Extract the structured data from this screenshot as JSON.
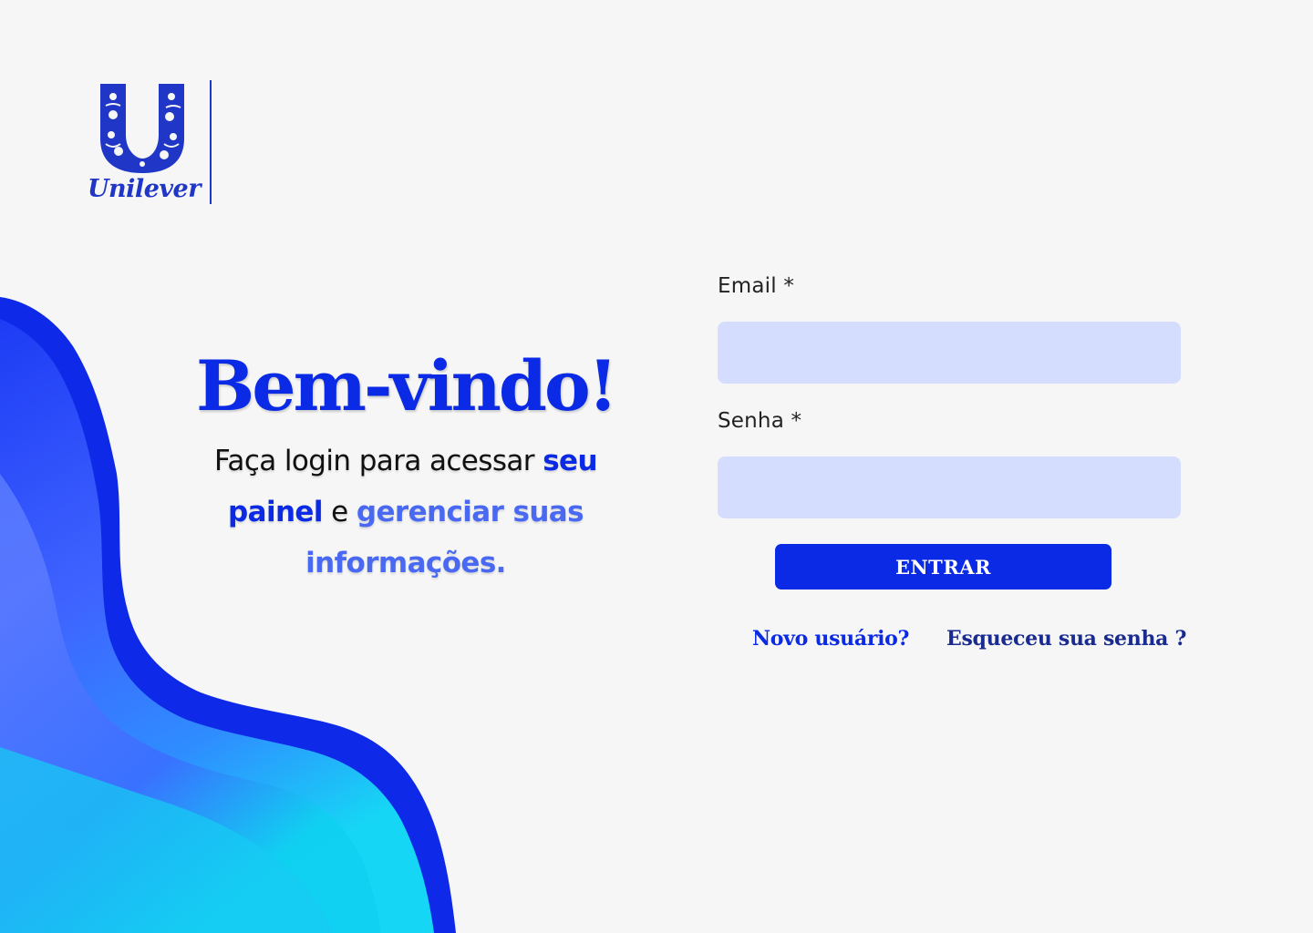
{
  "brand": {
    "name": "Unilever",
    "logo_icon": "unilever-u-logo-icon",
    "primary_color": "#0b2ae5",
    "accent_color": "#4a69f2",
    "input_bg_color": "#d5ddff",
    "background_color": "#f6f6f6"
  },
  "welcome": {
    "title": "Bem-vindo!",
    "subtitle_part1": "Faça login para acessar ",
    "subtitle_highlight1": "seu painel",
    "subtitle_part2": " e ",
    "subtitle_highlight2": "gerenciar suas informações."
  },
  "form": {
    "email_label": "Email *",
    "email_value": "",
    "senha_label": "Senha *",
    "senha_value": "",
    "submit_label": "ENTRAR"
  },
  "links": {
    "novo_usuario": "Novo usuário?",
    "esqueceu_senha": "Esqueceu sua senha ?"
  }
}
